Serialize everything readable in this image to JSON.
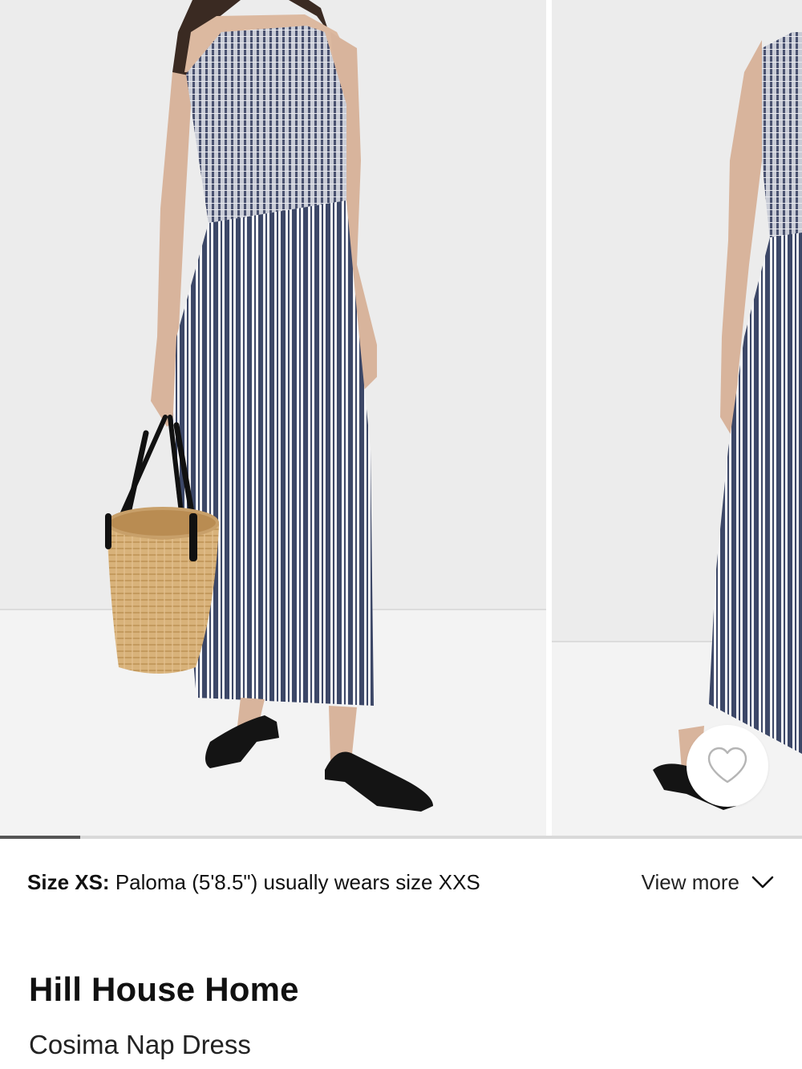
{
  "gallery": {
    "images": [
      {
        "name": "product-photo-1",
        "alt": ""
      },
      {
        "name": "product-photo-2",
        "alt": ""
      }
    ],
    "progress": 0.1,
    "favorite_icon": "heart-outline-icon"
  },
  "fit": {
    "size_label": "Size XS:",
    "model_info": "Paloma (5'8.5\") usually wears size XXS",
    "view_more_label": "View more",
    "view_more_icon": "chevron-down-icon"
  },
  "product": {
    "brand": "Hill House Home",
    "name": "Cosima Nap Dress"
  },
  "colors": {
    "background": "#ffffff",
    "photo_backdrop": "#ececec",
    "dress_navy": "#3c4767",
    "text": "#111111"
  }
}
